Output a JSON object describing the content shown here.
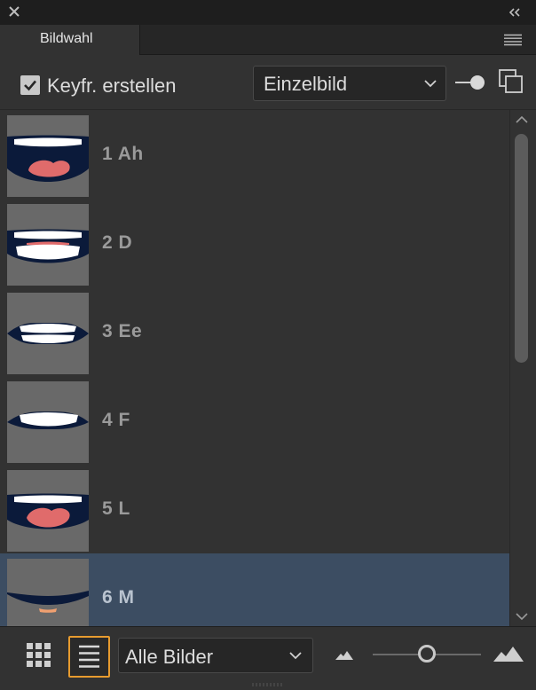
{
  "panel": {
    "tab_title": "Bildwahl"
  },
  "options": {
    "keyframe_checkbox_label": "Keyfr. erstellen",
    "keyframe_checked": true,
    "mode_select_value": "Einzelbild"
  },
  "list": {
    "items": [
      {
        "label": "1 Ah",
        "selected": false
      },
      {
        "label": "2 D",
        "selected": false
      },
      {
        "label": "3 Ee",
        "selected": false
      },
      {
        "label": "4 F",
        "selected": false
      },
      {
        "label": "5 L",
        "selected": false
      },
      {
        "label": "6 M",
        "selected": true
      }
    ]
  },
  "bottom": {
    "filter_select_value": "Alle Bilder",
    "active_view": "list",
    "thumbnail_size_fraction": 0.5
  },
  "colors": {
    "accent_outline": "#e79b2f",
    "selected_row": "#3c4d62",
    "mouth_dark": "#0b1a3a",
    "tongue": "#e06b6b"
  },
  "icons": {
    "close": "close-icon",
    "collapse": "double-chevron-left-icon",
    "panel_menu": "hamburger-menu-icon",
    "pin": "pin-icon",
    "copy": "copy-icon",
    "grid_view": "grid-view-icon",
    "list_view": "list-view-icon",
    "small_thumbnails": "small-mountain-icon",
    "large_thumbnails": "large-mountain-icon"
  }
}
